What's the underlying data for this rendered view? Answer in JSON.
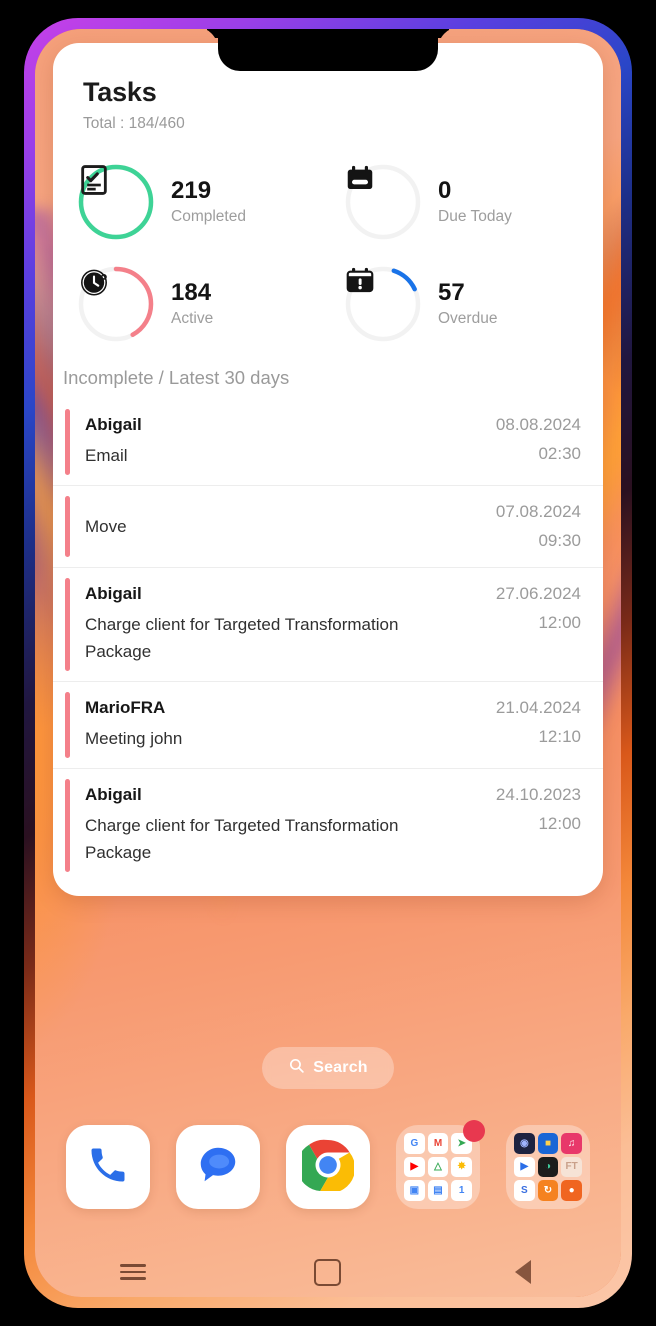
{
  "widget": {
    "title": "Tasks",
    "subtitle": "Total : 184/460",
    "section_title": "Incomplete / Latest 30 days",
    "stats": [
      {
        "value": "219",
        "label": "Completed",
        "icon": "checklist-icon",
        "ring_color": "#3ed396",
        "ring_pct": 100,
        "ring_start": -90
      },
      {
        "value": "0",
        "label": "Due Today",
        "icon": "calendar-icon",
        "ring_color": "#f0f0f0",
        "ring_pct": 0,
        "ring_start": -90
      },
      {
        "value": "184",
        "label": "Active",
        "icon": "clock-icon",
        "ring_color": "#f4808a",
        "ring_pct": 42,
        "ring_start": -90
      },
      {
        "value": "57",
        "label": "Overdue",
        "icon": "calendar-alert-icon",
        "ring_color": "#1a73e8",
        "ring_pct": 13,
        "ring_start": -72
      }
    ],
    "tasks": [
      {
        "name": "Abigail",
        "desc": "Email",
        "date": "08.08.2024",
        "time": "02:30",
        "accent": "#f4808a"
      },
      {
        "name": "",
        "desc": "Move",
        "date": "07.08.2024",
        "time": "09:30",
        "accent": "#f4808a"
      },
      {
        "name": "Abigail",
        "desc": "Charge client for Targeted Transformation Package",
        "date": "27.06.2024",
        "time": "12:00",
        "accent": "#f4808a"
      },
      {
        "name": "MarioFRA",
        "desc": "Meeting john",
        "date": "21.04.2024",
        "time": "12:10",
        "accent": "#f4808a"
      },
      {
        "name": "Abigail",
        "desc": "Charge client for Targeted Transformation Package",
        "date": "24.10.2023",
        "time": "12:00",
        "accent": "#f4808a"
      }
    ]
  },
  "search": {
    "label": "Search",
    "icon": "search-icon"
  },
  "dock": {
    "apps": [
      {
        "name": "phone-app",
        "icon": "phone-icon"
      },
      {
        "name": "messages-app",
        "icon": "message-bubble-icon"
      },
      {
        "name": "chrome-app",
        "icon": "chrome-icon"
      }
    ],
    "folders": [
      {
        "name": "google-folder",
        "has_badge": true,
        "badge_color": "#e8384f",
        "apps": [
          {
            "label": "G",
            "bg": "#ffffff",
            "fg": "#4285f4"
          },
          {
            "label": "M",
            "bg": "#ffffff",
            "fg": "#ea4335"
          },
          {
            "label": "➤",
            "bg": "#ffffff",
            "fg": "#34a853"
          },
          {
            "label": "▶",
            "bg": "#ffffff",
            "fg": "#ff0000"
          },
          {
            "label": "△",
            "bg": "#ffffff",
            "fg": "#34a853"
          },
          {
            "label": "✸",
            "bg": "#ffffff",
            "fg": "#fbbc05"
          },
          {
            "label": "▣",
            "bg": "#ffffff",
            "fg": "#4285f4"
          },
          {
            "label": "▤",
            "bg": "#ffffff",
            "fg": "#4285f4"
          },
          {
            "label": "1",
            "bg": "#ffffff",
            "fg": "#4285f4"
          }
        ]
      },
      {
        "name": "media-folder",
        "has_badge": false,
        "badge_color": "",
        "apps": [
          {
            "label": "◉",
            "bg": "#1e2340",
            "fg": "#9fb4ff"
          },
          {
            "label": "■",
            "bg": "#1a66d6",
            "fg": "#ffd24d"
          },
          {
            "label": "♫",
            "bg": "#e8386a",
            "fg": "#ffffff"
          },
          {
            "label": "▶",
            "bg": "#ffffff",
            "fg": "#2a6ee8"
          },
          {
            "label": "◑",
            "bg": "#1c1c1c",
            "fg": "#3fc79a"
          },
          {
            "label": "FT",
            "bg": "#f6e3d6",
            "fg": "#c9a08a"
          },
          {
            "label": "S",
            "bg": "#ffffff",
            "fg": "#3a6fe0"
          },
          {
            "label": "↻",
            "bg": "#f58220",
            "fg": "#ffffff"
          },
          {
            "label": "●",
            "bg": "#f06520",
            "fg": "#ffffff"
          }
        ]
      }
    ]
  },
  "navbar": {
    "recents_label": "recents",
    "home_label": "home",
    "back_label": "back"
  }
}
